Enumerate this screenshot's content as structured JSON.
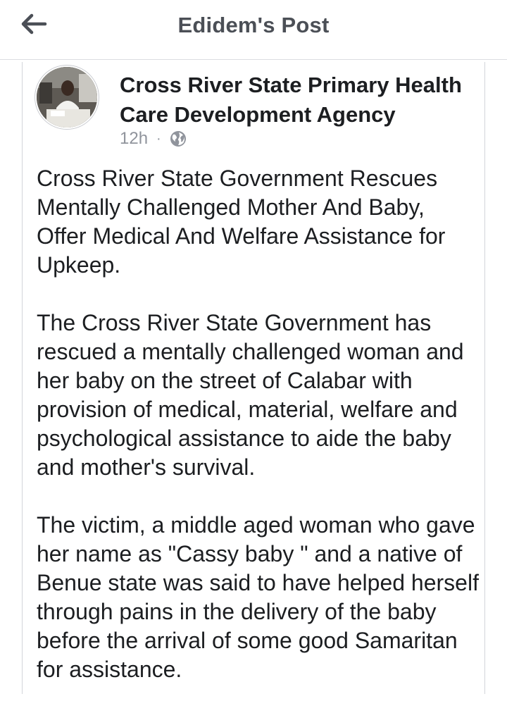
{
  "header": {
    "title": "Edidem's Post",
    "back_icon": "arrow-left-icon"
  },
  "post": {
    "author": "Cross River State Primary Health Care Development Agency",
    "time": "12h",
    "separator": "·",
    "privacy_icon": "globe-icon",
    "paragraphs": [
      "Cross River State Government Rescues Mentally Challenged Mother And Baby, Offer Medical And Welfare  Assistance for Upkeep.",
      "The Cross River State Government has rescued a mentally challenged woman and her baby on the street of Calabar with provision of medical, material, welfare and psychological assistance to aide the baby and mother's survival.",
      "The victim, a middle aged woman who gave her name as \"Cassy baby \" and a native of Benue state was said to have helped herself through  pains in the delivery of the baby before the arrival of some good Samaritan for assistance."
    ]
  },
  "colors": {
    "title_gray": "#4b4f56",
    "meta_gray": "#90949c",
    "text": "#1c1e21",
    "divider": "#dcdde1"
  }
}
